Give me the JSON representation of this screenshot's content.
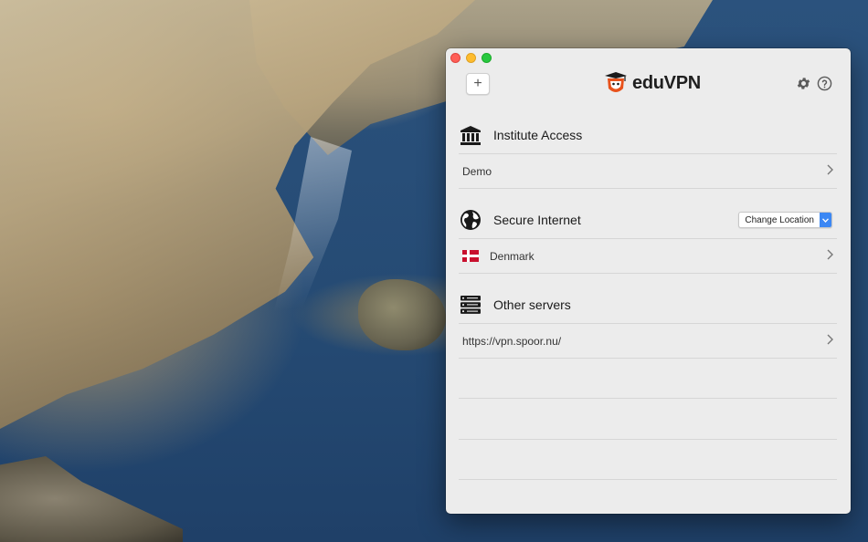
{
  "app": {
    "logo_text_edu": "edu",
    "logo_text_vpn": "VPN"
  },
  "toolbar": {
    "add_label": "+"
  },
  "sections": {
    "institute": {
      "title": "Institute Access",
      "items": [
        {
          "label": "Demo"
        }
      ]
    },
    "secure": {
      "title": "Secure Internet",
      "change_location_label": "Change Location",
      "items": [
        {
          "label": "Denmark"
        }
      ]
    },
    "other": {
      "title": "Other servers",
      "items": [
        {
          "label": "https://vpn.spoor.nu/"
        }
      ]
    }
  },
  "colors": {
    "accent": "#3b87f4",
    "logo_orange": "#e8521c"
  }
}
